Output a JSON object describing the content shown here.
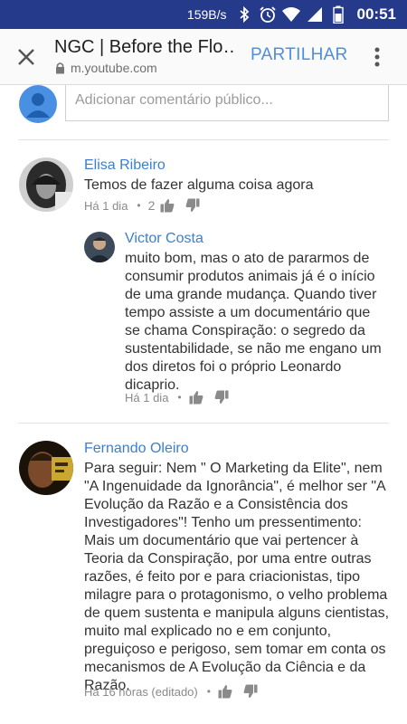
{
  "status_bar": {
    "network_speed": "159B/s",
    "time": "00:51",
    "icons": [
      "bluetooth-icon",
      "alarm-icon",
      "wifi-icon",
      "battery-icon"
    ]
  },
  "tab_bar": {
    "title": "NGC | Before the Flo…",
    "url": "m.youtube.com",
    "share_label": "PARTILHAR"
  },
  "add_comment": {
    "placeholder": "Adicionar comentário público..."
  },
  "comments": [
    {
      "author": "Elisa Ribeiro",
      "text": "Temos de fazer alguma coisa agora",
      "time": "Há 1 dia",
      "likes": "2",
      "replies": [
        {
          "author": "Victor Costa",
          "text": "muito bom, mas o ato de pararmos de consumir produtos animais já é o início de uma grande mudança. Quando tiver tempo assiste a um documentário que se chama Conspiração: o segredo da sustentabilidade, se não me engano um dos diretos foi o próprio Leonardo dicaprio.",
          "time": "Há 1 dia"
        }
      ]
    },
    {
      "author": "Fernando Oleiro",
      "text": "Para seguir: Nem \" O Marketing da Elite\", nem \"A Ingenuidade da Ignorância\", é melhor ser \"A Evolução da Razão e a Consistência dos Investigadores\"! Tenho um pressentimento: Mais um documentário que vai pertencer à Teoria da Conspiração, por uma entre outras razões, é feito por e para criacionistas, tipo milagre para o protagonismo, o velho problema de quem sustenta e manipula alguns cientistas, muito mal explicado no e em conjunto, preguiçoso e perigoso, sem tomar em conta os mecanismos de A Evolução da Ciência e da Razão.",
      "time": "Há 16 horas (editado)"
    }
  ],
  "colors": {
    "status_bar": "#253a8a",
    "accent_blue": "#4a90e2",
    "author_blue": "#3b7fd0"
  }
}
